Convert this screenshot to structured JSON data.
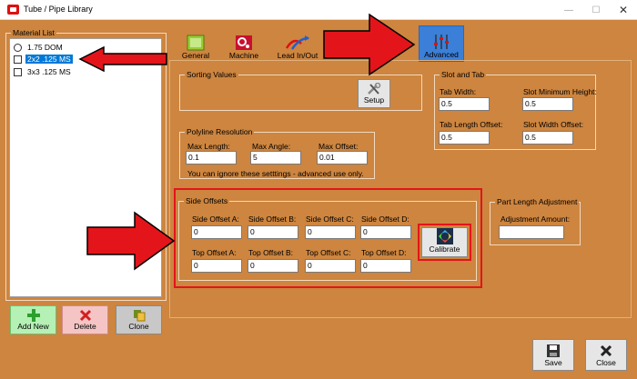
{
  "window": {
    "title": "Tube / Pipe Library"
  },
  "material_list": {
    "label": "Material List",
    "items": [
      {
        "label": "1.75 DOM",
        "marker": "radio",
        "selected": false
      },
      {
        "label": "2x2 .125 MS",
        "marker": "checkbox",
        "selected": true
      },
      {
        "label": "3x3 .125 MS",
        "marker": "checkbox",
        "selected": false
      }
    ]
  },
  "list_buttons": {
    "add_new": "Add New",
    "delete": "Delete",
    "clone": "Clone"
  },
  "tabs": [
    {
      "label": "General",
      "icon": "general-icon"
    },
    {
      "label": "Machine",
      "icon": "machine-icon"
    },
    {
      "label": "Lead In/Out",
      "icon": "lead-in-out-icon"
    },
    {
      "label": "Advanced",
      "icon": "advanced-sliders-icon",
      "active": true
    }
  ],
  "sorting": {
    "label": "Sorting Values",
    "setup_button": "Setup"
  },
  "slot_tab": {
    "label": "Slot and Tab",
    "tab_width_label": "Tab Width:",
    "tab_width": "0.5",
    "slot_min_height_label": "Slot Minimum Height:",
    "slot_min_height": "0.5",
    "tab_length_offset_label": "Tab Length Offset:",
    "tab_length_offset": "0.5",
    "slot_width_offset_label": "Slot Width Offset:",
    "slot_width_offset": "0.5"
  },
  "polyline": {
    "label": "Polyline Resolution",
    "max_length_label": "Max Length:",
    "max_length": "0.1",
    "max_angle_label": "Max Angle:",
    "max_angle": "5",
    "max_offset_label": "Max Offset:",
    "max_offset": "0.01",
    "note": "You can ignore these setttings - advanced use only."
  },
  "side_offsets": {
    "label": "Side Offsets",
    "side_a_label": "Side Offset A:",
    "side_a": "0",
    "side_b_label": "Side Offset B:",
    "side_b": "0",
    "side_c_label": "Side Offset C:",
    "side_c": "0",
    "side_d_label": "Side Offset D:",
    "side_d": "0",
    "top_a_label": "Top Offset A:",
    "top_a": "0",
    "top_b_label": "Top Offset B:",
    "top_b": "0",
    "top_c_label": "Top Offset C:",
    "top_c": "0",
    "top_d_label": "Top Offset D:",
    "top_d": "0",
    "calibrate_button": "Calibrate"
  },
  "part_length": {
    "label": "Part Length Adjustment",
    "adjustment_label": "Adjustment Amount:",
    "adjustment": ""
  },
  "footer": {
    "save": "Save",
    "close": "Close"
  },
  "colors": {
    "background": "#cd853f",
    "accent": "#3b7fd8",
    "highlight_red": "#e3151a"
  }
}
